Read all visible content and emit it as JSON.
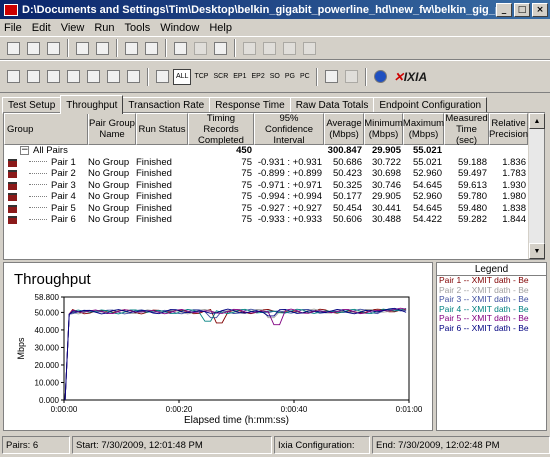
{
  "window": {
    "title": "D:\\Documents and Settings\\Tim\\Desktop\\belkin_gigabit_powerline_hd\\new_fw\\belkin_gig_pwr_hd_loca_6x...",
    "minimize": "_",
    "maximize": "□",
    "close": "×"
  },
  "menu": [
    "File",
    "Edit",
    "View",
    "Run",
    "Tools",
    "Window",
    "Help"
  ],
  "toolbar2_text": [
    "ALL",
    "TCP",
    "SCR",
    "EP1",
    "EP2",
    "SO",
    "PG",
    "PC"
  ],
  "brand": {
    "prefix": "✕",
    "name": "IXIA"
  },
  "tabs": [
    "Test Setup",
    "Throughput",
    "Transaction Rate",
    "Response Time",
    "Raw Data Totals",
    "Endpoint Configuration"
  ],
  "table": {
    "headers": [
      "Group",
      "Pair Group Name",
      "Run Status",
      "Timing Records Completed",
      "95% Confidence Interval",
      "Average (Mbps)",
      "Minimum (Mbps)",
      "Maximum (Mbps)",
      "Measured Time (sec)",
      "Relative Precision"
    ],
    "summary": {
      "label": "All Pairs",
      "records": "450",
      "average": "300.847",
      "minimum": "29.905",
      "maximum": "55.021"
    },
    "rows": [
      {
        "pair": "Pair 1",
        "group": "No Group",
        "status": "Finished",
        "records": "75",
        "ci": "-0.931 : +0.931",
        "avg": "50.686",
        "min": "30.722",
        "max": "55.021",
        "time": "59.188",
        "rp": "1.836"
      },
      {
        "pair": "Pair 2",
        "group": "No Group",
        "status": "Finished",
        "records": "75",
        "ci": "-0.899 : +0.899",
        "avg": "50.423",
        "min": "30.698",
        "max": "52.960",
        "time": "59.497",
        "rp": "1.783"
      },
      {
        "pair": "Pair 3",
        "group": "No Group",
        "status": "Finished",
        "records": "75",
        "ci": "-0.971 : +0.971",
        "avg": "50.325",
        "min": "30.746",
        "max": "54.645",
        "time": "59.613",
        "rp": "1.930"
      },
      {
        "pair": "Pair 4",
        "group": "No Group",
        "status": "Finished",
        "records": "75",
        "ci": "-0.994 : +0.994",
        "avg": "50.177",
        "min": "29.905",
        "max": "52.960",
        "time": "59.780",
        "rp": "1.980"
      },
      {
        "pair": "Pair 5",
        "group": "No Group",
        "status": "Finished",
        "records": "75",
        "ci": "-0.927 : +0.927",
        "avg": "50.454",
        "min": "30.441",
        "max": "54.645",
        "time": "59.480",
        "rp": "1.838"
      },
      {
        "pair": "Pair 6",
        "group": "No Group",
        "status": "Finished",
        "records": "75",
        "ci": "-0.933 : +0.933",
        "avg": "50.606",
        "min": "30.488",
        "max": "54.422",
        "time": "59.282",
        "rp": "1.844"
      }
    ]
  },
  "chart_data": {
    "type": "line",
    "title": "Throughput",
    "xlabel": "Elapsed time (h:mm:ss)",
    "ylabel": "Mbps",
    "xlim": [
      0,
      60
    ],
    "ylim": [
      0,
      58.8
    ],
    "yticks": [
      "58.800",
      "50.000",
      "40.000",
      "30.000",
      "20.000",
      "10.000",
      "0.000"
    ],
    "xticks": [
      "0:00:00",
      "0:00:20",
      "0:00:40",
      "0:01:00"
    ],
    "grid": false,
    "series": [
      {
        "name": "Pair 1 -- XMIT dath - Be",
        "color": "#800000",
        "dip_at": 27,
        "dip_value": 43
      },
      {
        "name": "Pair 2 -- XMIT dath - Be",
        "color": "#a0a0a0",
        "dip_at": 36,
        "dip_value": 46
      },
      {
        "name": "Pair 3 -- XMIT dath - Be",
        "color": "#4050a0",
        "dip_at": 26,
        "dip_value": 46
      },
      {
        "name": "Pair 4 -- XMIT dath - Be",
        "color": "#008080",
        "dip_at": 25,
        "dip_value": 44
      },
      {
        "name": "Pair 5 -- XMIT dath - Be",
        "color": "#800080",
        "dip_at": 37,
        "dip_value": 42
      },
      {
        "name": "Pair 6 -- XMIT dath - Be",
        "color": "#000080",
        "dip_at": 36,
        "dip_value": 47
      }
    ],
    "legend_title": "Legend"
  },
  "status": {
    "pairs": "Pairs: 6",
    "start": "Start: 7/30/2009, 12:01:48 PM",
    "config": "Ixia Configuration:",
    "end": "End: 7/30/2009, 12:02:48 PM"
  }
}
